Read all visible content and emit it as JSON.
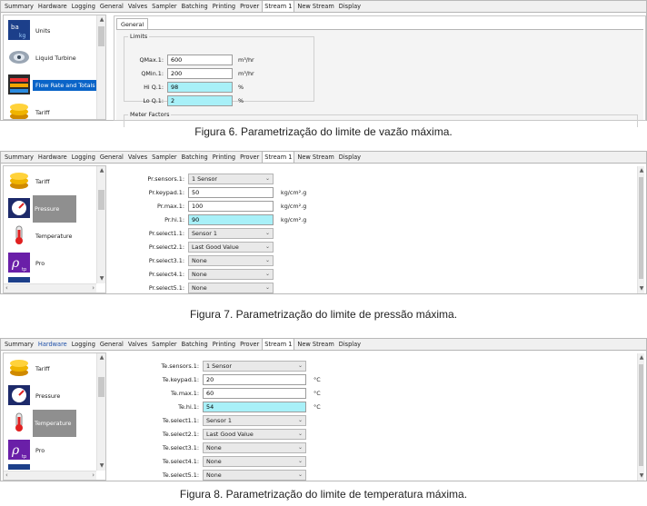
{
  "tabs": [
    "Summary",
    "Hardware",
    "Logging",
    "General",
    "Valves",
    "Sampler",
    "Batching",
    "Printing",
    "Prover",
    "Stream 1",
    "New Stream",
    "Display"
  ],
  "fig1": {
    "sidebar": [
      "Units",
      "Liquid Turbine",
      "Flow Rate and Totals",
      "Tariff"
    ],
    "inner_tab": "General",
    "group": "Limits",
    "rows": [
      {
        "label": "QMax.1:",
        "value": "600",
        "unit": "m³/hr"
      },
      {
        "label": "QMin.1:",
        "value": "200",
        "unit": "m³/hr"
      },
      {
        "label": "Hi Q.1:",
        "value": "98",
        "unit": "%"
      },
      {
        "label": "Lo Q.1:",
        "value": "2",
        "unit": "%"
      }
    ],
    "group2": "Meter Factors",
    "caption": "Figura 6. Parametrização do limite de vazão máxima."
  },
  "fig2": {
    "sidebar": [
      "Tariff",
      "Pressure",
      "Temperature",
      "Pro"
    ],
    "rows": [
      {
        "label": "Pr.sensors.1:",
        "value": "1 Sensor",
        "kind": "select",
        "unit": ""
      },
      {
        "label": "Pr.keypad.1:",
        "value": "50",
        "kind": "input",
        "unit": "kg/cm².g"
      },
      {
        "label": "Pr.max.1:",
        "value": "100",
        "kind": "input",
        "unit": "kg/cm².g"
      },
      {
        "label": "Pr.hi.1:",
        "value": "90",
        "kind": "cyan",
        "unit": "kg/cm².g"
      },
      {
        "label": "Pr.select1.1:",
        "value": "Sensor 1",
        "kind": "select",
        "unit": ""
      },
      {
        "label": "Pr.select2.1:",
        "value": "Last Good Value",
        "kind": "select",
        "unit": ""
      },
      {
        "label": "Pr.select3.1:",
        "value": "None",
        "kind": "select",
        "unit": ""
      },
      {
        "label": "Pr.select4.1:",
        "value": "None",
        "kind": "select",
        "unit": ""
      },
      {
        "label": "Pr.select5.1:",
        "value": "None",
        "kind": "select",
        "unit": ""
      }
    ],
    "caption": "Figura 7. Parametrização do limite de pressão máxima."
  },
  "fig3": {
    "sidebar": [
      "Tariff",
      "Pressure",
      "Temperature",
      "Pro"
    ],
    "rows": [
      {
        "label": "Te.sensors.1:",
        "value": "1 Sensor",
        "kind": "select",
        "unit": ""
      },
      {
        "label": "Te.keypad.1:",
        "value": "20",
        "kind": "input",
        "unit": "°C"
      },
      {
        "label": "Te.max.1:",
        "value": "60",
        "kind": "input",
        "unit": "°C"
      },
      {
        "label": "Te.hi.1:",
        "value": "54",
        "kind": "cyan",
        "unit": "°C"
      },
      {
        "label": "Te.select1.1:",
        "value": "Sensor 1",
        "kind": "select",
        "unit": ""
      },
      {
        "label": "Te.select2.1:",
        "value": "Last Good Value",
        "kind": "select",
        "unit": ""
      },
      {
        "label": "Te.select3.1:",
        "value": "None",
        "kind": "select",
        "unit": ""
      },
      {
        "label": "Te.select4.1:",
        "value": "None",
        "kind": "select",
        "unit": ""
      },
      {
        "label": "Te.select5.1:",
        "value": "None",
        "kind": "select",
        "unit": ""
      }
    ],
    "caption": "Figura 8. Parametrização do limite de temperatura máxima."
  },
  "colors": {
    "highlight_input": "#a8f0f8",
    "selected_item": "#0a64c8",
    "gray_selected": "#8f8f8f"
  }
}
